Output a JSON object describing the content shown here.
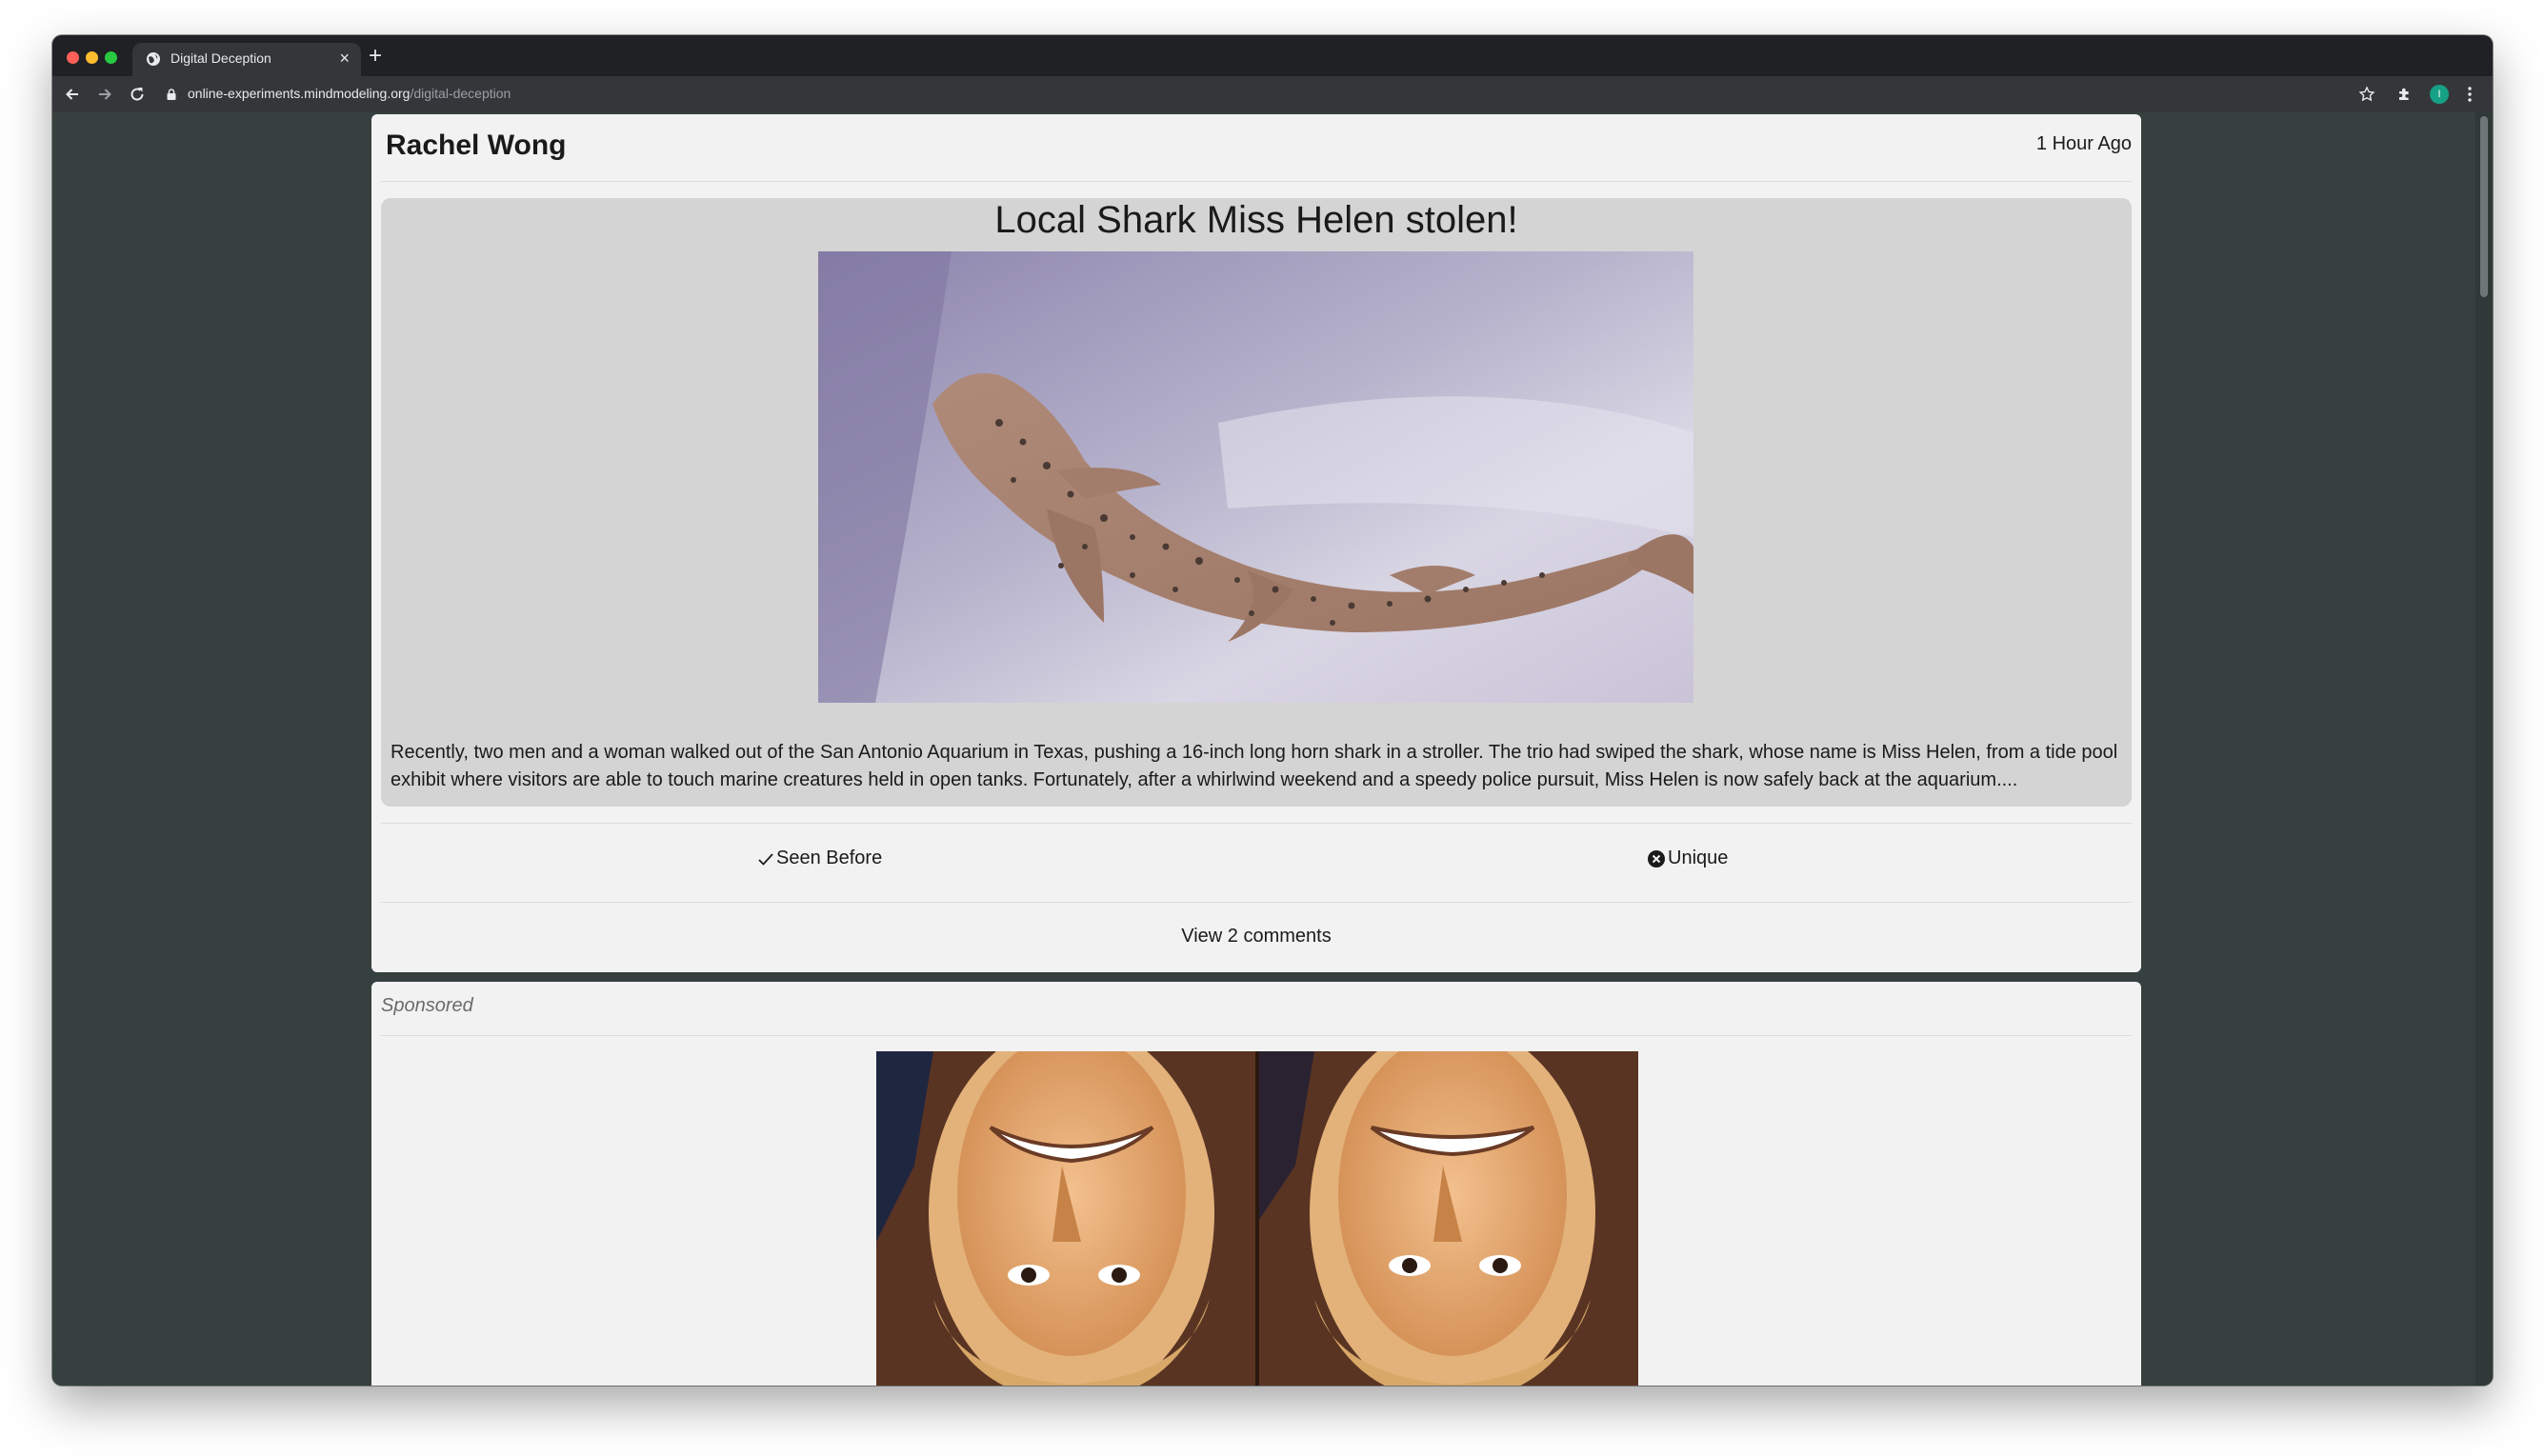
{
  "browser": {
    "tab_title": "Digital Deception",
    "tab_close": "×",
    "new_tab": "+",
    "url_host": "online-experiments.mindmodeling.org",
    "url_path": "/digital-deception",
    "profile_initial": "I"
  },
  "post": {
    "author": "Rachel Wong",
    "time": "1 Hour Ago",
    "headline": "Local Shark Miss Helen stolen!",
    "image_icon": "shark-photo",
    "body": "Recently, two men and a woman walked out of the San Antonio Aquarium in Texas, pushing a 16-inch long horn shark in a stroller. The trio had swiped the shark, whose name is Miss Helen, from a tide pool exhibit where visitors are able to touch marine creatures held in open tanks. Fortunately, after a whirlwind weekend and a speedy police pursuit, Miss Helen is now safely back at the aquarium....",
    "actions": {
      "seen_before": "Seen Before",
      "unique": "Unique"
    },
    "comments_link": "View 2 comments"
  },
  "sponsored": {
    "label": "Sponsored",
    "image_icon": "upside-down-faces-photo"
  },
  "colors": {
    "page_bg": "#35403f",
    "card_bg": "#f2f2f2",
    "post_bg": "#d4d4d4"
  }
}
